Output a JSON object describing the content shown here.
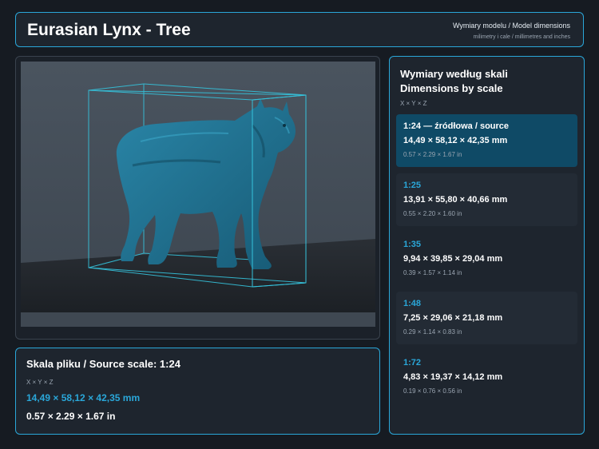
{
  "header": {
    "title": "Eurasian Lynx - Tree",
    "subtitle": "Wymiary modelu / Model dimensions",
    "units_note": "milimetry i cale / millimetres and inches"
  },
  "source": {
    "title": "Skala pliku / Source scale: 1:24",
    "axes": "X × Y × Z",
    "mm": "14,49 × 58,12 × 42,35 mm",
    "inches": "0.57 × 2.29 × 1.67 in"
  },
  "scales": {
    "title_pl": "Wymiary według skali",
    "title_en": "Dimensions by scale",
    "axes": "X × Y × Z",
    "items": [
      {
        "scale": "1:24  —  źródłowa / source",
        "mm": "14,49 × 58,12 × 42,35 mm",
        "inches": "0.57 × 2.29 × 1.67 in",
        "active": true
      },
      {
        "scale": "1:25",
        "mm": "13,91 × 55,80 × 40,66 mm",
        "inches": "0.55 × 2.20 × 1.60 in",
        "active": false
      },
      {
        "scale": "1:35",
        "mm": "9,94 × 39,85 × 29,04 mm",
        "inches": "0.39 × 1.57 × 1.14 in",
        "active": false
      },
      {
        "scale": "1:48",
        "mm": "7,25 × 29,06 × 21,18 mm",
        "inches": "0.29 × 1.14 × 0.83 in",
        "active": false
      },
      {
        "scale": "1:72",
        "mm": "4,83 × 19,37 × 14,12 mm",
        "inches": "0.19 × 0.76 × 0.56 in",
        "active": false
      }
    ]
  },
  "colors": {
    "accent": "#2aa7d9",
    "background": "#161b22",
    "panel": "#1e252e",
    "active_card": "#0f4a66",
    "model": "#1f6f8f"
  }
}
